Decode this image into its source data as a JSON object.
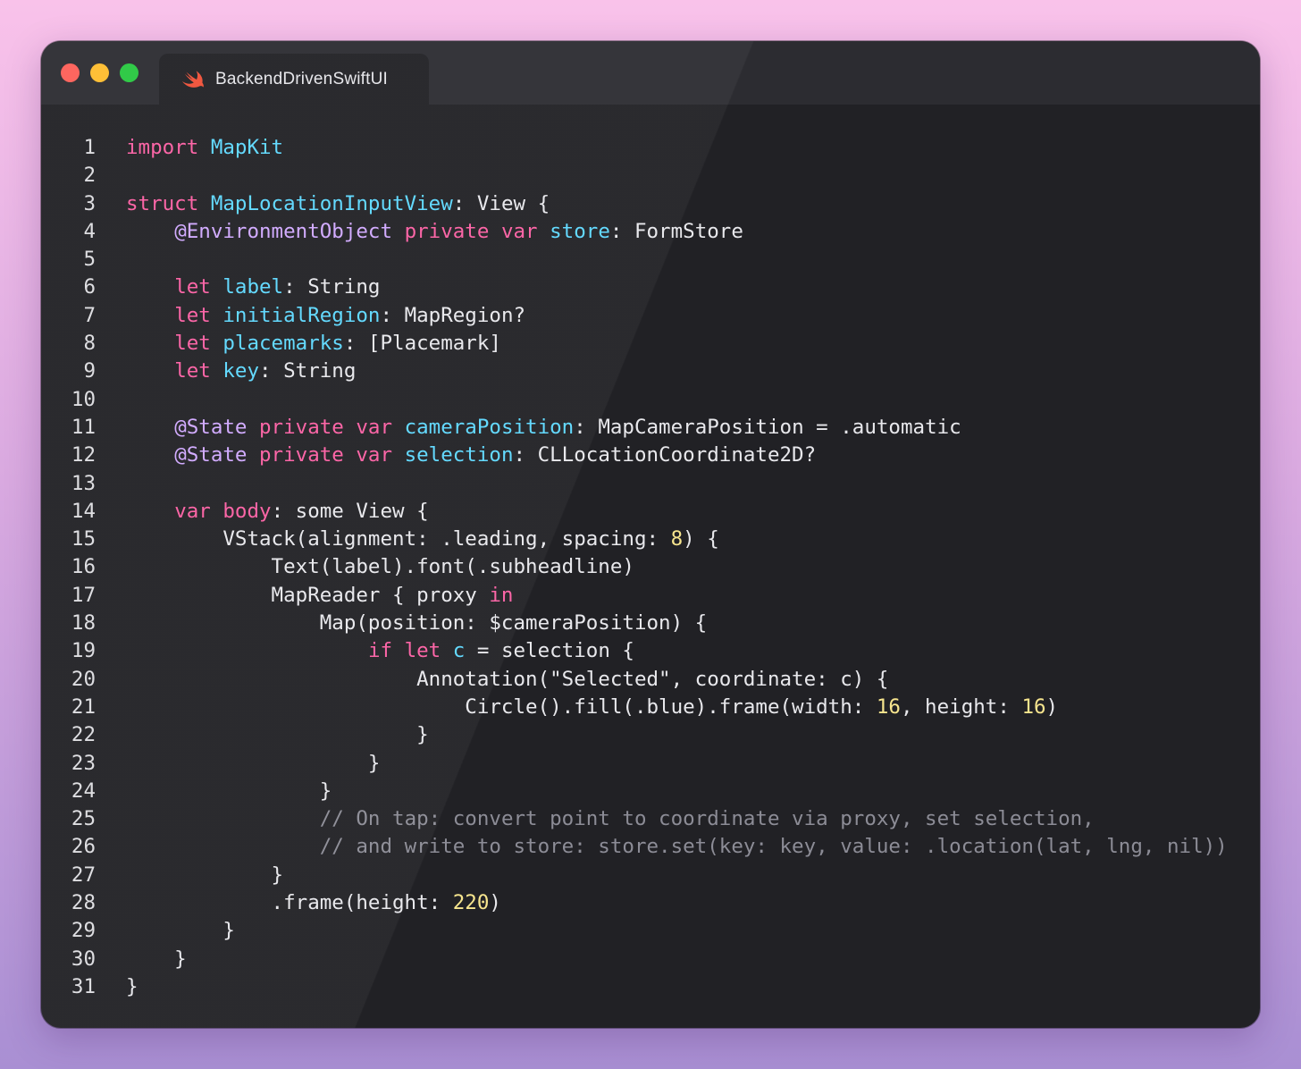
{
  "window": {
    "tab_title": "BackendDrivenSwiftUI",
    "icon": "swift-logo-icon",
    "colors": {
      "background_top": "#f9c2ea",
      "background_bottom": "#a98fd3",
      "editor": "#212125",
      "titlebar": "#2c2c31",
      "close": "#fe5f58",
      "minimize": "#febc2e",
      "zoom": "#28c840",
      "keyword": "#fc5fa3",
      "type": "#5dd8ff",
      "attribute": "#d0a8ff",
      "number": "#f7e58e",
      "comment": "#8c8c96",
      "plain": "#e8e8ec"
    }
  },
  "code": {
    "lines": [
      {
        "n": "1",
        "tokens": [
          [
            "kw",
            "import"
          ],
          [
            "p",
            " "
          ],
          [
            "ty",
            "MapKit"
          ]
        ]
      },
      {
        "n": "2",
        "tokens": []
      },
      {
        "n": "3",
        "tokens": [
          [
            "kw",
            "struct"
          ],
          [
            "p",
            " "
          ],
          [
            "ty",
            "MapLocationInputView"
          ],
          [
            "p",
            ": View {"
          ]
        ]
      },
      {
        "n": "4",
        "tokens": [
          [
            "p",
            "    "
          ],
          [
            "at",
            "@EnvironmentObject"
          ],
          [
            "p",
            " "
          ],
          [
            "kw",
            "private"
          ],
          [
            "p",
            " "
          ],
          [
            "kw",
            "var"
          ],
          [
            "p",
            " "
          ],
          [
            "ty",
            "store"
          ],
          [
            "p",
            ": FormStore"
          ]
        ]
      },
      {
        "n": "5",
        "tokens": []
      },
      {
        "n": "6",
        "tokens": [
          [
            "p",
            "    "
          ],
          [
            "kw",
            "let"
          ],
          [
            "p",
            " "
          ],
          [
            "ty",
            "label"
          ],
          [
            "p",
            ": String"
          ]
        ]
      },
      {
        "n": "7",
        "tokens": [
          [
            "p",
            "    "
          ],
          [
            "kw",
            "let"
          ],
          [
            "p",
            " "
          ],
          [
            "ty",
            "initialRegion"
          ],
          [
            "p",
            ": MapRegion?"
          ]
        ]
      },
      {
        "n": "8",
        "tokens": [
          [
            "p",
            "    "
          ],
          [
            "kw",
            "let"
          ],
          [
            "p",
            " "
          ],
          [
            "ty",
            "placemarks"
          ],
          [
            "p",
            ": [Placemark]"
          ]
        ]
      },
      {
        "n": "9",
        "tokens": [
          [
            "p",
            "    "
          ],
          [
            "kw",
            "let"
          ],
          [
            "p",
            " "
          ],
          [
            "ty",
            "key"
          ],
          [
            "p",
            ": String"
          ]
        ]
      },
      {
        "n": "10",
        "tokens": []
      },
      {
        "n": "11",
        "tokens": [
          [
            "p",
            "    "
          ],
          [
            "at",
            "@State"
          ],
          [
            "p",
            " "
          ],
          [
            "kw",
            "private"
          ],
          [
            "p",
            " "
          ],
          [
            "kw",
            "var"
          ],
          [
            "p",
            " "
          ],
          [
            "ty",
            "cameraPosition"
          ],
          [
            "p",
            ": MapCameraPosition = .automatic"
          ]
        ]
      },
      {
        "n": "12",
        "tokens": [
          [
            "p",
            "    "
          ],
          [
            "at",
            "@State"
          ],
          [
            "p",
            " "
          ],
          [
            "kw",
            "private"
          ],
          [
            "p",
            " "
          ],
          [
            "kw",
            "var"
          ],
          [
            "p",
            " "
          ],
          [
            "ty",
            "selection"
          ],
          [
            "p",
            ": CLLocationCoordinate2D?"
          ]
        ]
      },
      {
        "n": "13",
        "tokens": []
      },
      {
        "n": "14",
        "tokens": [
          [
            "p",
            "    "
          ],
          [
            "kw",
            "var"
          ],
          [
            "p",
            " "
          ],
          [
            "kw",
            "body"
          ],
          [
            "p",
            ": some View {"
          ]
        ]
      },
      {
        "n": "15",
        "tokens": [
          [
            "p",
            "        VStack(alignment: .leading, spacing: "
          ],
          [
            "num",
            "8"
          ],
          [
            "p",
            ") {"
          ]
        ]
      },
      {
        "n": "16",
        "tokens": [
          [
            "p",
            "            Text(label).font(.subheadline)"
          ]
        ]
      },
      {
        "n": "17",
        "tokens": [
          [
            "p",
            "            MapReader { proxy "
          ],
          [
            "kw",
            "in"
          ]
        ]
      },
      {
        "n": "18",
        "tokens": [
          [
            "p",
            "                Map(position: $cameraPosition) {"
          ]
        ]
      },
      {
        "n": "19",
        "tokens": [
          [
            "p",
            "                    "
          ],
          [
            "kw",
            "if"
          ],
          [
            "p",
            " "
          ],
          [
            "kw",
            "let"
          ],
          [
            "p",
            " "
          ],
          [
            "ty",
            "c"
          ],
          [
            "p",
            " = selection {"
          ]
        ]
      },
      {
        "n": "20",
        "tokens": [
          [
            "p",
            "                        Annotation(\"Selected\", coordinate: c) {"
          ]
        ]
      },
      {
        "n": "21",
        "tokens": [
          [
            "p",
            "                            Circle().fill(.blue).frame(width: "
          ],
          [
            "num",
            "16"
          ],
          [
            "p",
            ", height: "
          ],
          [
            "num",
            "16"
          ],
          [
            "p",
            ")"
          ]
        ]
      },
      {
        "n": "22",
        "tokens": [
          [
            "p",
            "                        }"
          ]
        ]
      },
      {
        "n": "23",
        "tokens": [
          [
            "p",
            "                    }"
          ]
        ]
      },
      {
        "n": "24",
        "tokens": [
          [
            "p",
            "                }"
          ]
        ]
      },
      {
        "n": "25",
        "tokens": [
          [
            "p",
            "                "
          ],
          [
            "cm",
            "// On tap: convert point to coordinate via proxy, set selection,"
          ]
        ]
      },
      {
        "n": "26",
        "tokens": [
          [
            "p",
            "                "
          ],
          [
            "cm",
            "// and write to store: store.set(key: key, value: .location(lat, lng, nil))"
          ]
        ]
      },
      {
        "n": "27",
        "tokens": [
          [
            "p",
            "            }"
          ]
        ]
      },
      {
        "n": "28",
        "tokens": [
          [
            "p",
            "            .frame(height: "
          ],
          [
            "num",
            "220"
          ],
          [
            "p",
            ")"
          ]
        ]
      },
      {
        "n": "29",
        "tokens": [
          [
            "p",
            "        }"
          ]
        ]
      },
      {
        "n": "30",
        "tokens": [
          [
            "p",
            "    }"
          ]
        ]
      },
      {
        "n": "31",
        "tokens": [
          [
            "p",
            "}"
          ]
        ]
      }
    ]
  }
}
